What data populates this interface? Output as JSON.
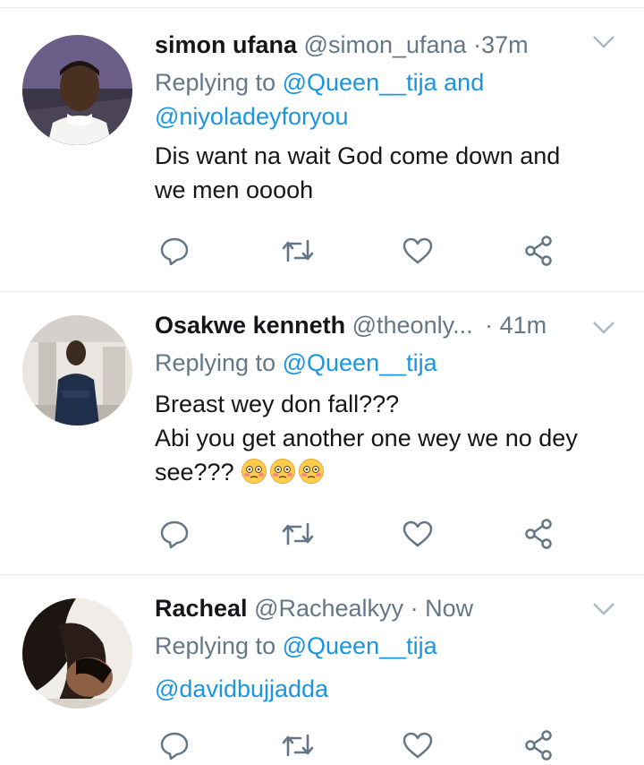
{
  "tweets": [
    {
      "name": "simon ufana",
      "handle": "@simon_ufana",
      "dot": "·",
      "time": "37m",
      "replying_prefix": "Replying to",
      "reply_line1_mention": "@Queen__tija",
      "reply_line1_and": "and",
      "reply_line2_mention": "@niyoladeyforyou",
      "text_line1": "Dis want na wait God come down and",
      "text_line2": "we men ooooh"
    },
    {
      "name": "Osakwe kenneth",
      "handle": "@theonly...",
      "dot": "·",
      "time": "41m",
      "replying_prefix": "Replying to",
      "reply_line1_mention": "@Queen__tija",
      "text_line1": "Breast wey don fall???",
      "text_line2": "Abi you get another one wey we no dey",
      "text_line3": "see???",
      "emojis": [
        "flushed-face-emoji",
        "flushed-face-emoji",
        "flushed-face-emoji"
      ]
    },
    {
      "name": "Racheal",
      "handle": "@Rachealkyy",
      "dot": "·",
      "time": "Now",
      "replying_prefix": "Replying to",
      "reply_line1_mention": "@Queen__tija",
      "reply_line2_mention": "@davidbujjadda"
    }
  ],
  "actions": [
    "reply-icon",
    "retweet-icon",
    "like-icon",
    "share-icon"
  ],
  "colors": {
    "link": "#1b95e0",
    "meta": "#657786",
    "icon": "#657786",
    "divider": "#e6ecf0"
  }
}
